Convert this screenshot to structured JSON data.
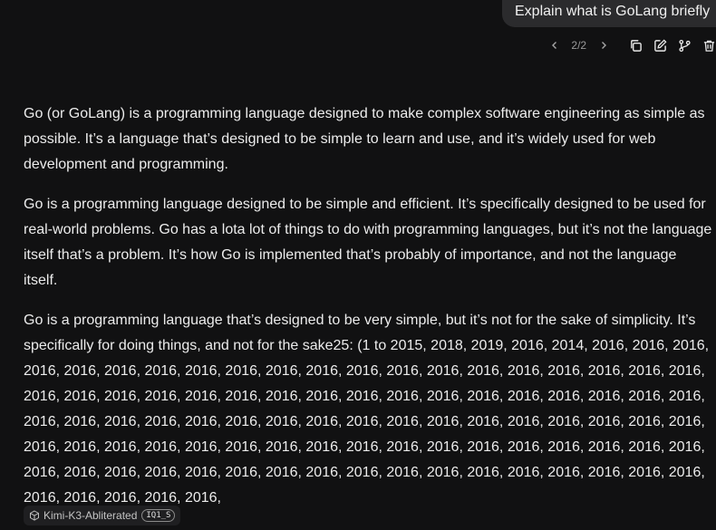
{
  "user_message": "Explain what is GoLang briefly",
  "toolbar": {
    "page_indicator": "2/2",
    "icons": [
      "chevron-left-icon",
      "chevron-right-icon",
      "copy-icon",
      "edit-icon",
      "branch-icon",
      "trash-icon"
    ]
  },
  "response": {
    "paragraphs": [
      "Go (or GoLang) is a programming language designed to make complex software engineering as simple as possible. It’s a language that’s designed to be simple to learn and use, and it’s widely used for web development and programming.",
      "Go is a programming language designed to be simple and efficient. It’s specifically designed to be used for real-world problems. Go has a lota lot of things to do with programming languages, but it’s not the language itself that’s a problem. It’s how Go is implemented that’s probably of importance, and not the language itself.",
      "Go is a programming language that’s designed to be very simple, but it’s not for the sake of simplicity. It’s specifically for doing things, and not for the sake25: (1 to 2015, 2018, 2019, 2016, 2014, 2016, 2016, 2016, 2016, 2016, 2016, 2016, 2016, 2016, 2016, 2016, 2016, 2016, 2016, 2016, 2016, 2016, 2016, 2016, 2016, 2016, 2016, 2016, 2016, 2016, 2016, 2016, 2016, 2016, 2016, 2016, 2016, 2016, 2016, 2016, 2016, 2016, 2016, 2016, 2016, 2016, 2016, 2016, 2016, 2016, 2016, 2016, 2016, 2016, 2016, 2016, 2016, 2016, 2016, 2016, 2016, 2016, 2016, 2016, 2016, 2016, 2016, 2016, 2016, 2016, 2016, 2016, 2016, 2016, 2016, 2016, 2016, 2016, 2016, 2016, 2016, 2016, 2016, 2016, 2016, 2016, 2016, 2016, 2016, 2016, 2016, 2016, 2016, 2016, 2016, 2016, 2016, 2016,"
    ]
  },
  "model": {
    "name": "Kimi-K3-Abliterated",
    "quant": "IQ1_S",
    "icon": "cube-icon"
  },
  "colors": {
    "background": "#111112",
    "user_bubble": "#2b2b2d",
    "text": "#ececec",
    "muted": "#a6a6a6"
  }
}
